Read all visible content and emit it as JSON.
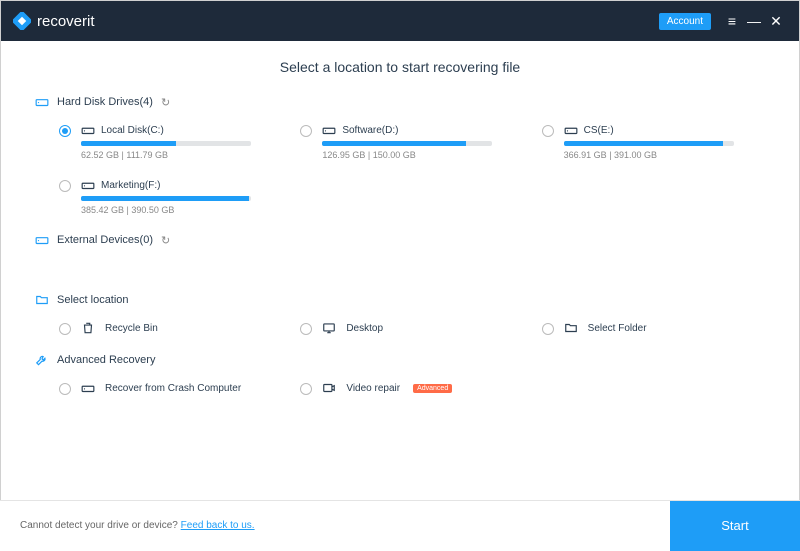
{
  "header": {
    "brand": "recoverit",
    "account_label": "Account"
  },
  "title": "Select a location to start recovering file",
  "sections": {
    "hdd": {
      "label": "Hard Disk Drives(4)"
    },
    "ext": {
      "label": "External Devices(0)"
    },
    "select_loc": {
      "label": "Select location"
    },
    "advanced": {
      "label": "Advanced Recovery"
    }
  },
  "drives": [
    {
      "label": "Local Disk(C:)",
      "used": 62.52,
      "total": 111.79,
      "size_text": "62.52  GB | 111.79  GB",
      "selected": true
    },
    {
      "label": "Software(D:)",
      "used": 126.95,
      "total": 150.0,
      "size_text": "126.95  GB | 150.00  GB",
      "selected": false
    },
    {
      "label": "CS(E:)",
      "used": 366.91,
      "total": 391.0,
      "size_text": "366.91  GB | 391.00  GB",
      "selected": false
    },
    {
      "label": "Marketing(F:)",
      "used": 385.42,
      "total": 390.5,
      "size_text": "385.42  GB | 390.50  GB",
      "selected": false
    }
  ],
  "locations": [
    {
      "label": "Recycle Bin"
    },
    {
      "label": "Desktop"
    },
    {
      "label": "Select Folder"
    }
  ],
  "advanced_options": [
    {
      "label": "Recover from Crash Computer",
      "badge": ""
    },
    {
      "label": "Video repair",
      "badge": "Advanced"
    }
  ],
  "footer": {
    "prompt": "Cannot detect your drive or device? ",
    "link": "Feed back to us.",
    "start": "Start"
  }
}
